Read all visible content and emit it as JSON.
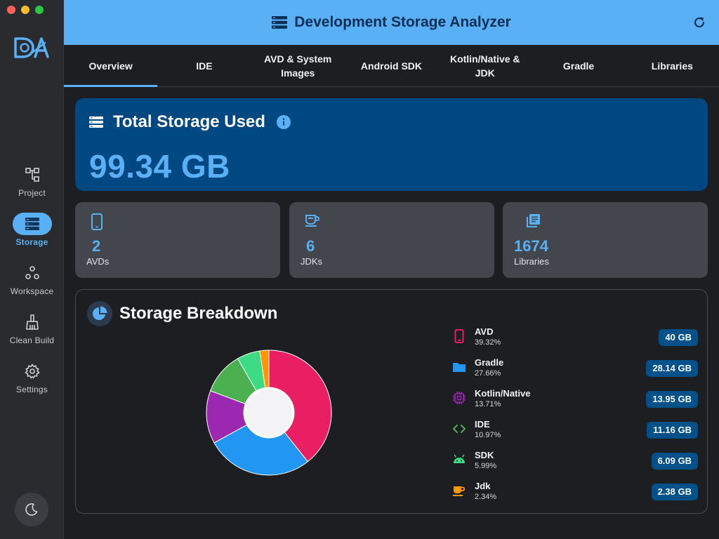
{
  "window": {
    "title": "Development Storage Analyzer"
  },
  "colors": {
    "accent": "#5ab0f5",
    "header_bg": "#5ab0f5",
    "total_card_bg": "#004881",
    "badge_bg": "#00508a"
  },
  "sidebar": {
    "logo_icon": "da-logo-icon",
    "items": [
      {
        "label": "Project",
        "icon": "hierarchy-icon",
        "active": false
      },
      {
        "label": "Storage",
        "icon": "storage-icon",
        "active": true
      },
      {
        "label": "Workspace",
        "icon": "workspace-icon",
        "active": false
      },
      {
        "label": "Clean Build",
        "icon": "broom-icon",
        "active": false
      },
      {
        "label": "Settings",
        "icon": "gear-icon",
        "active": false
      }
    ],
    "theme_toggle_icon": "moon-icon"
  },
  "tabs": [
    {
      "label": "Overview",
      "active": true
    },
    {
      "label": "IDE"
    },
    {
      "label": "AVD & System Images"
    },
    {
      "label": "Android SDK"
    },
    {
      "label": "Kotlin/Native & JDK"
    },
    {
      "label": "Gradle"
    },
    {
      "label": "Libraries"
    }
  ],
  "total": {
    "title": "Total Storage Used",
    "value": "99.34 GB",
    "info_icon": "info-icon"
  },
  "stats": [
    {
      "value": "2",
      "label": "AVDs",
      "icon": "phone-icon"
    },
    {
      "value": "6",
      "label": "JDKs",
      "icon": "coffee-icon"
    },
    {
      "value": "1674",
      "label": "Libraries",
      "icon": "library-icon"
    }
  ],
  "breakdown": {
    "title": "Storage Breakdown",
    "items": [
      {
        "name": "AVD",
        "percent": "39.32%",
        "size": "40 GB",
        "color": "#e91e63",
        "icon": "phone-icon"
      },
      {
        "name": "Gradle",
        "percent": "27.66%",
        "size": "28.14 GB",
        "color": "#2196f3",
        "icon": "folder-icon"
      },
      {
        "name": "Kotlin/Native",
        "percent": "13.71%",
        "size": "13.95 GB",
        "color": "#9c27b0",
        "icon": "chip-icon"
      },
      {
        "name": "IDE",
        "percent": "10.97%",
        "size": "11.16 GB",
        "color": "#4caf50",
        "icon": "code-icon"
      },
      {
        "name": "SDK",
        "percent": "5.99%",
        "size": "6.09 GB",
        "color": "#3ddc84",
        "icon": "android-icon"
      },
      {
        "name": "Jdk",
        "percent": "2.34%",
        "size": "2.38 GB",
        "color": "#ff9800",
        "icon": "coffee-icon"
      }
    ]
  },
  "chart_data": {
    "type": "pie",
    "categories": [
      "AVD",
      "Gradle",
      "Kotlin/Native",
      "IDE",
      "SDK",
      "Jdk"
    ],
    "values": [
      39.32,
      27.66,
      13.71,
      10.97,
      5.99,
      2.34
    ],
    "colors": [
      "#e91e63",
      "#2196f3",
      "#9c27b0",
      "#4caf50",
      "#3ddc84",
      "#ff9800"
    ],
    "title": "Storage Breakdown",
    "hole": true,
    "legend": "right"
  }
}
